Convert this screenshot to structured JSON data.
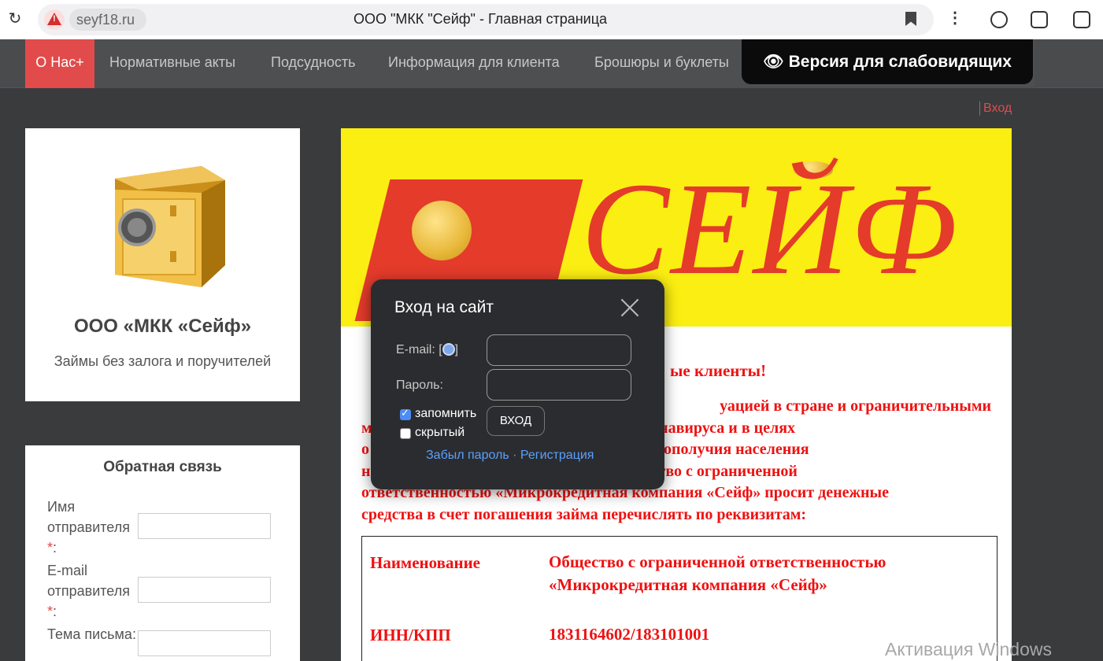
{
  "browser": {
    "domain": "seyf18.ru",
    "tab_title": "ООО \"МКК \"Сейф\" - Главная страница",
    "warning_glyph": "!"
  },
  "nav": {
    "active": "О Нас",
    "active_suffix": "+",
    "items": [
      "Нормативные акты",
      "Подсудность",
      "Информация для клиента",
      "Брошюры и буклеты"
    ],
    "vision_button": "Версия для слабовидящих"
  },
  "header_login": "Вход",
  "brand": {
    "name": "ООО «МКК «Сейф»",
    "tagline": "Займы без залога и поручителей"
  },
  "feedback": {
    "title": "Обратная связь",
    "fields": [
      {
        "label": "Имя отправителя",
        "required_mark": "*",
        "colon": ":"
      },
      {
        "label": "E-mail отправителя",
        "required_mark": "*",
        "colon": ":"
      },
      {
        "label": "Тема письма:"
      }
    ]
  },
  "banner": {
    "logo_text": "СЕЙФ",
    "colors": {
      "background": "#fbee12",
      "red": "#e43b2b"
    }
  },
  "notice": {
    "heading_visible": "ые клиенты!",
    "body_lines": [
      "уацией в стране и ограничительными",
      "м                                              ранением коронавируса и в целях",
      "о                                              огического благополучия населения",
      "н                                              ерации, Общество с ограниченной",
      "ответственностью «Микрокредитная компания «Сейф» просит денежные",
      "средства в счет погашения займа перечислять по реквизитам:"
    ]
  },
  "requisites": [
    {
      "label": "Наименование",
      "value": "Общество с ограниченной ответственностью «Микрокредитная компания «Сейф»"
    },
    {
      "label": "ИНН/КПП",
      "value": "1831164602/183101001"
    }
  ],
  "watermark": "Активация Windows",
  "login_modal": {
    "title": "Вход на сайт",
    "email_label": "E-mail: [",
    "email_label_end": "]",
    "password_label": "Пароль:",
    "remember_label": "запомнить",
    "remember_checked": true,
    "hidden_label": "скрытый",
    "hidden_checked": false,
    "submit": "ВХОД",
    "forgot": "Забыл пароль",
    "separator": "·",
    "register": "Регистрация"
  }
}
